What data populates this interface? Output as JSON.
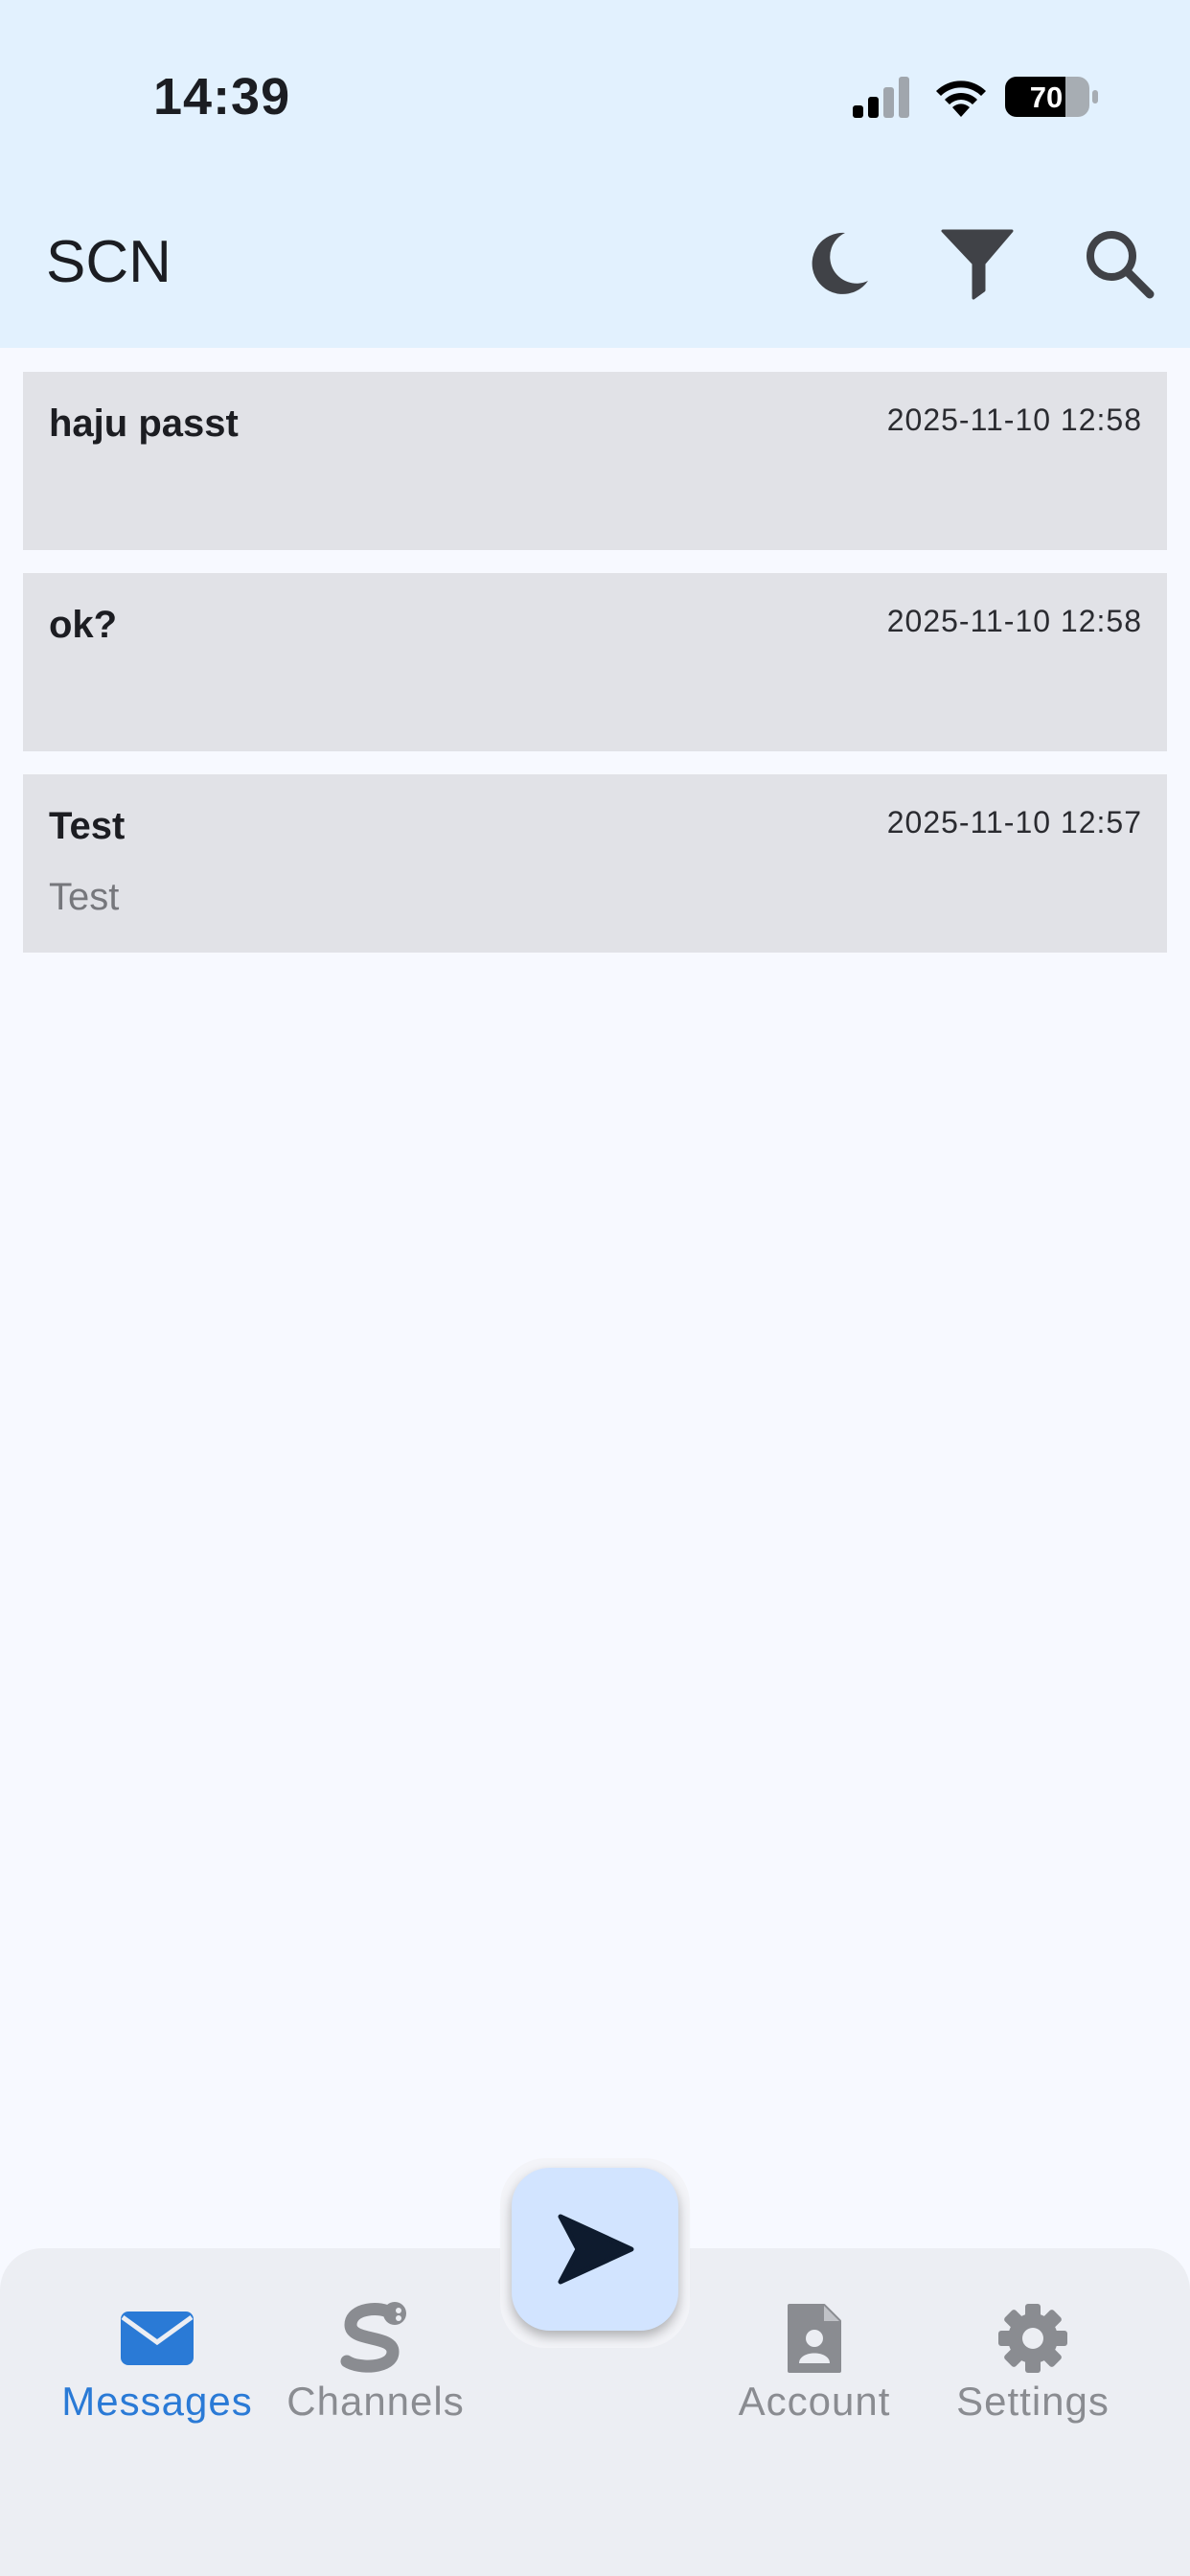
{
  "status_bar": {
    "time": "14:39",
    "battery": "70"
  },
  "app_bar": {
    "title": "SCN"
  },
  "messages": [
    {
      "title": "haju passt",
      "date": "2025-11-10 12:58",
      "body": ""
    },
    {
      "title": "ok?",
      "date": "2025-11-10 12:58",
      "body": ""
    },
    {
      "title": "Test",
      "date": "2025-11-10 12:57",
      "body": "Test"
    }
  ],
  "nav": {
    "messages": "Messages",
    "channels": "Channels",
    "account": "Account",
    "settings": "Settings"
  },
  "colors": {
    "app_bar_bg": "#e2f1fe",
    "background": "#f7f9ff",
    "message_card": "#e1e2e7",
    "active_nav": "#2a7ad6",
    "inactive_nav": "#8a8c91",
    "fab_bg": "#d2e4ff"
  },
  "icons": {
    "top": [
      "moon-icon",
      "filter-icon",
      "search-icon"
    ],
    "nav": [
      "envelope-icon",
      "channel-icon",
      "account-icon",
      "gear-icon"
    ],
    "fab": "send-icon"
  }
}
